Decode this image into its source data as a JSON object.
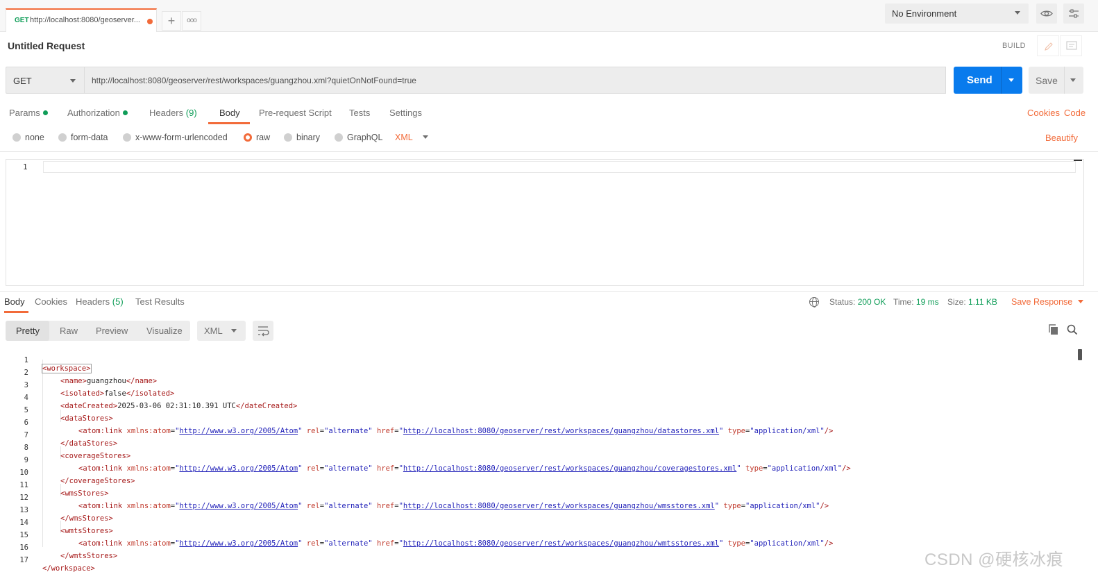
{
  "tabbar": {
    "tab_method": "GET",
    "tab_title": "http://localhost:8080/geoserver...",
    "new_tab_symbol": "+",
    "more_symbol": "ooo",
    "environment": "No Environment",
    "icons": [
      "eye-icon",
      "sliders-icon"
    ]
  },
  "request": {
    "name": "Untitled Request",
    "build_label": "BUILD",
    "method": "GET",
    "url": "http://localhost:8080/geoserver/rest/workspaces/guangzhou.xml?quietOnNotFound=true",
    "send_label": "Send",
    "save_label": "Save"
  },
  "request_tabs": {
    "params": "Params",
    "authorization": "Authorization",
    "headers": "Headers",
    "headers_count": "(9)",
    "body": "Body",
    "prerequest": "Pre-request Script",
    "tests": "Tests",
    "settings": "Settings",
    "cookies": "Cookies",
    "code": "Code"
  },
  "body_types": {
    "none": "none",
    "form_data": "form-data",
    "urlencoded": "x-www-form-urlencoded",
    "raw": "raw",
    "binary": "binary",
    "graphql": "GraphQL",
    "raw_type": "XML",
    "beautify": "Beautify"
  },
  "editor": {
    "line_number": "1"
  },
  "response": {
    "tabs": {
      "body": "Body",
      "cookies": "Cookies",
      "headers": "Headers",
      "headers_count": "(5)",
      "test_results": "Test Results"
    },
    "status_label": "Status:",
    "status_value": "200 OK",
    "time_label": "Time:",
    "time_value": "19 ms",
    "size_label": "Size:",
    "size_value": "1.11 KB",
    "save_response": "Save Response",
    "views": {
      "pretty": "Pretty",
      "raw": "Raw",
      "preview": "Preview",
      "visualize": "Visualize"
    },
    "format": "XML",
    "code": {
      "line_numbers": [
        "1",
        "2",
        "3",
        "4",
        "5",
        "6",
        "7",
        "8",
        "9",
        "10",
        "11",
        "12",
        "13",
        "14",
        "15",
        "16",
        "17"
      ],
      "workspace_open": "<workspace>",
      "name_open": "<name>",
      "name_value": "guangzhou",
      "name_close": "</name>",
      "isolated_open": "<isolated>",
      "isolated_value": "false",
      "isolated_close": "</isolated>",
      "datecreated_open": "<dateCreated>",
      "datecreated_value": "2025-03-06 02:31:10.391 UTC",
      "datecreated_close": "</dateCreated>",
      "datastores_open": "<dataStores>",
      "datastores_close": "</dataStores>",
      "coveragestores_open": "<coverageStores>",
      "coveragestores_close": "</coverageStores>",
      "wmsstores_open": "<wmsStores>",
      "wmsstores_close": "</wmsStores>",
      "wmtsstores_open": "<wmtsStores>",
      "wmtsstores_close": "</wmtsStores>",
      "workspace_close": "</workspace>",
      "link_tag": "<atom:link",
      "xmlns_attr": "xmlns:atom",
      "xmlns_value": "http://www.w3.org/2005/Atom",
      "rel_attr": "rel",
      "rel_value": "\"alternate\"",
      "href_attr": "href",
      "type_attr": "type",
      "type_value": "\"application/xml\"",
      "self_close": "/>",
      "eq": "=",
      "quote": "\"",
      "href_datastores": "http://localhost:8080/geoserver/rest/workspaces/guangzhou/datastores.xml",
      "href_coveragestores": "http://localhost:8080/geoserver/rest/workspaces/guangzhou/coveragestores.xml",
      "href_wmsstores": "http://localhost:8080/geoserver/rest/workspaces/guangzhou/wmsstores.xml",
      "href_wmtsstores": "http://localhost:8080/geoserver/rest/workspaces/guangzhou/wmtsstores.xml"
    }
  },
  "watermark": "CSDN @硬核冰痕",
  "colors": {
    "accent": "#f26b3a",
    "send": "#097bed",
    "success": "#0f9d58"
  }
}
